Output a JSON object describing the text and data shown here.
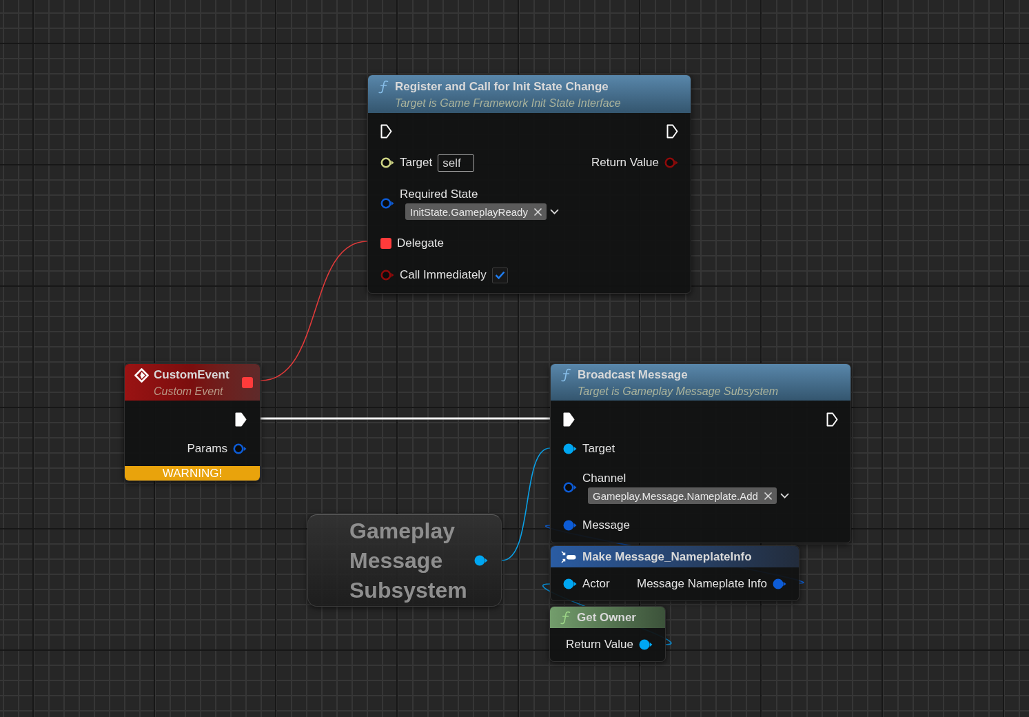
{
  "nodes": [
    {
      "kind": "function",
      "title": "Register and Call for Init State Change",
      "subtitle": "Target is Game Framework Init State Interface",
      "inputs": [
        {
          "kind": "exec",
          "connected": false
        },
        {
          "kind": "interface",
          "label": "Target",
          "connected": false,
          "default": {
            "kind": "text",
            "value": "self"
          }
        },
        {
          "kind": "struct",
          "label": "Required State",
          "connected": false,
          "default": {
            "kind": "tag",
            "value": "InitState.GameplayReady"
          }
        },
        {
          "kind": "delegate",
          "label": "Delegate",
          "connected": true
        },
        {
          "kind": "bool",
          "label": "Call Immediately",
          "connected": false,
          "default": {
            "kind": "checkbox",
            "checked": true
          }
        }
      ],
      "outputs": [
        {
          "kind": "exec",
          "connected": false
        },
        {
          "kind": "bool",
          "label": "Return Value",
          "connected": false
        }
      ]
    },
    {
      "kind": "event",
      "title": "CustomEvent",
      "subtitle": "Custom Event",
      "header_pin": {
        "kind": "delegate",
        "connected": true
      },
      "outputs": [
        {
          "kind": "exec",
          "connected": true
        },
        {
          "kind": "struct",
          "label": "Params",
          "connected": false
        }
      ],
      "warning": "WARNING!"
    },
    {
      "kind": "function",
      "title": "Broadcast Message",
      "subtitle": "Target is Gameplay Message Subsystem",
      "inputs": [
        {
          "kind": "exec",
          "connected": true
        },
        {
          "kind": "object",
          "label": "Target",
          "connected": true
        },
        {
          "kind": "struct",
          "label": "Channel",
          "connected": false,
          "default": {
            "kind": "tag",
            "value": "Gameplay.Message.Nameplate.Add"
          }
        },
        {
          "kind": "struct",
          "label": "Message",
          "connected": true
        }
      ],
      "outputs": [
        {
          "kind": "exec",
          "connected": false
        }
      ]
    },
    {
      "kind": "variable",
      "title": "Gameplay Message Subsystem",
      "outputs": [
        {
          "kind": "object",
          "connected": true
        }
      ]
    },
    {
      "kind": "make_struct",
      "title": "Make Message_NameplateInfo",
      "inputs": [
        {
          "kind": "object",
          "label": "Actor",
          "connected": true
        }
      ],
      "outputs": [
        {
          "kind": "struct",
          "label": "Message Nameplate Info",
          "connected": true
        }
      ]
    },
    {
      "kind": "pure_function",
      "title": "Get Owner",
      "outputs": [
        {
          "kind": "object",
          "label": "Return Value",
          "connected": true
        }
      ]
    }
  ]
}
